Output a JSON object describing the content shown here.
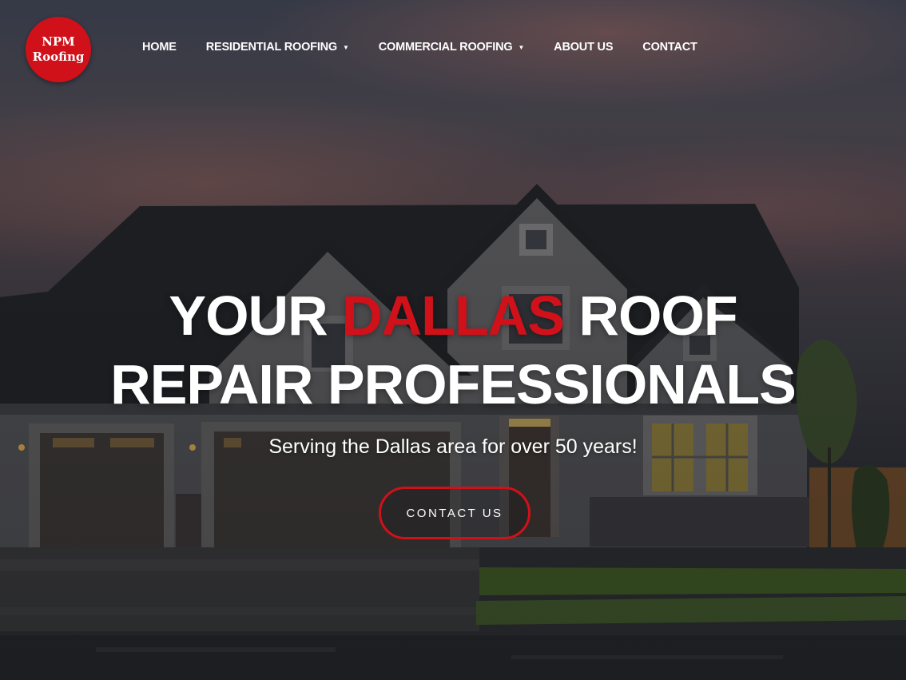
{
  "brand": {
    "logo_line1": "NPM",
    "logo_line2": "Roofing",
    "accent_color": "#d0111a"
  },
  "nav": {
    "items": [
      {
        "label": "HOME",
        "has_dropdown": false
      },
      {
        "label": "RESIDENTIAL ROOFING",
        "has_dropdown": true
      },
      {
        "label": "COMMERCIAL ROOFING",
        "has_dropdown": true
      },
      {
        "label": "ABOUT US",
        "has_dropdown": false
      },
      {
        "label": "CONTACT",
        "has_dropdown": false
      }
    ],
    "dropdown_icon": "caret-down-icon"
  },
  "hero": {
    "headline_part1": "YOUR ",
    "headline_accent": "DALLAS",
    "headline_part2": " ROOF",
    "headline_line2": "REPAIR PROFESSIONALS",
    "subheadline": "Serving the Dallas area for over 50 years!",
    "cta_label": "CONTACT US",
    "background_image": "house-at-dusk-photo"
  }
}
